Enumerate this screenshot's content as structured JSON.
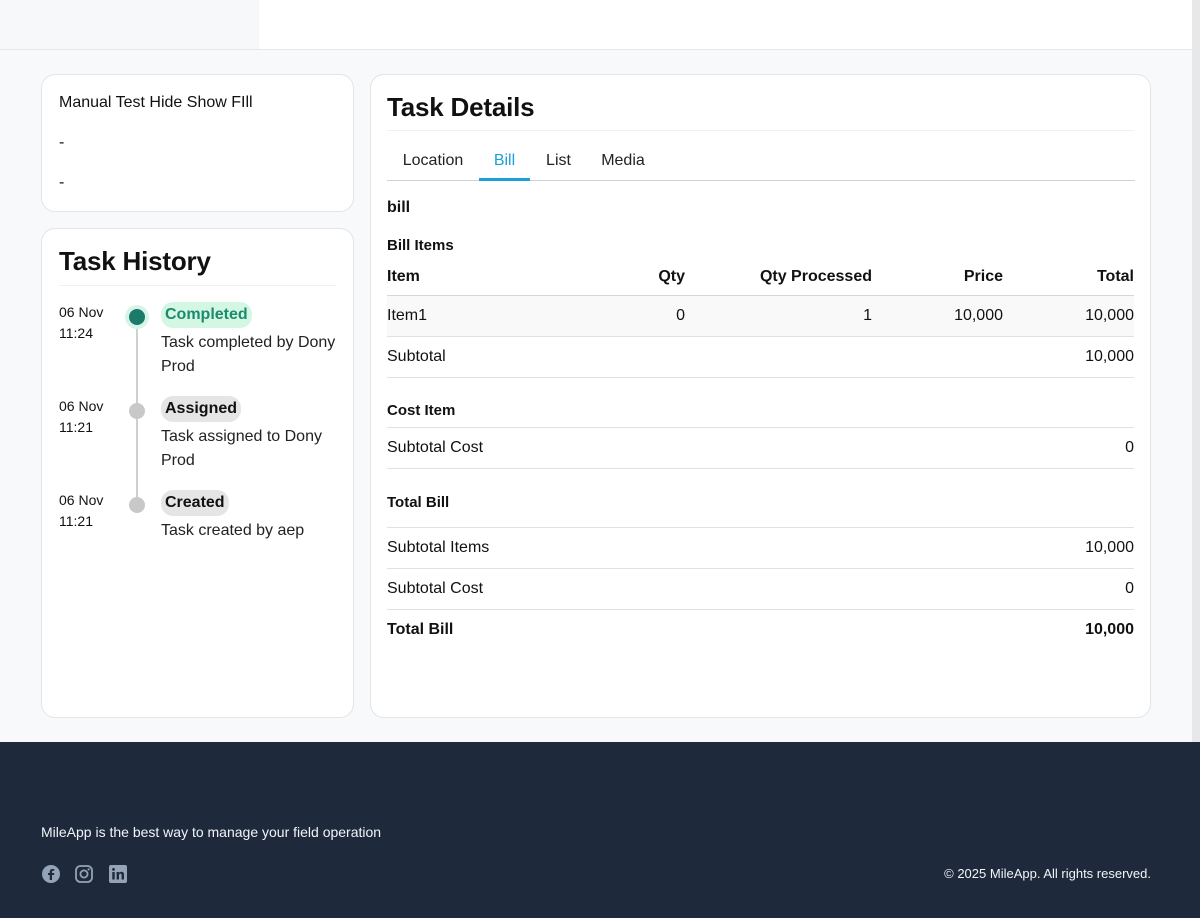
{
  "info": {
    "title": "Manual Test Hide Show FIll",
    "line2": "-",
    "line3": "-"
  },
  "history": {
    "title": "Task History",
    "items": [
      {
        "date": "06 Nov",
        "time": "11:24",
        "status": "Completed",
        "desc": "Task completed by Dony Prod"
      },
      {
        "date": "06 Nov",
        "time": "11:21",
        "status": "Assigned",
        "desc": "Task assigned to Dony Prod"
      },
      {
        "date": "06 Nov",
        "time": "11:21",
        "status": "Created",
        "desc": "Task created by aep"
      }
    ]
  },
  "details": {
    "title": "Task Details",
    "tabs": [
      "Location",
      "Bill",
      "List",
      "Media"
    ],
    "active_tab": "Bill",
    "section": "bill",
    "bill_items_label": "Bill Items",
    "columns": [
      "Item",
      "Qty",
      "Qty Processed",
      "Price",
      "Total"
    ],
    "rows": [
      {
        "item": "Item1",
        "qty": "0",
        "qty_processed": "1",
        "price": "10,000",
        "total": "10,000"
      }
    ],
    "subtotal_label": "Subtotal",
    "subtotal_value": "10,000",
    "cost_item_label": "Cost Item",
    "subtotal_cost_label": "Subtotal Cost",
    "subtotal_cost_value": "0",
    "total_bill_label": "Total Bill",
    "summary": {
      "subtotal_items_label": "Subtotal Items",
      "subtotal_items_value": "10,000",
      "subtotal_cost_label": "Subtotal Cost",
      "subtotal_cost_value": "0",
      "total_bill_label": "Total Bill",
      "total_bill_value": "10,000"
    }
  },
  "footer": {
    "tagline": "MileApp is the best way to manage your field operation",
    "copyright": "© 2025 MileApp. All rights reserved.",
    "social_icons": [
      "facebook-icon",
      "instagram-icon",
      "linkedin-icon"
    ],
    "background_color": "#1e293b"
  },
  "colors": {
    "accent": "#1aa1d8",
    "completed_badge_bg": "#d4f7e4",
    "completed_badge_text": "#1c8a6e",
    "completed_dot": "#1c7a6a"
  }
}
